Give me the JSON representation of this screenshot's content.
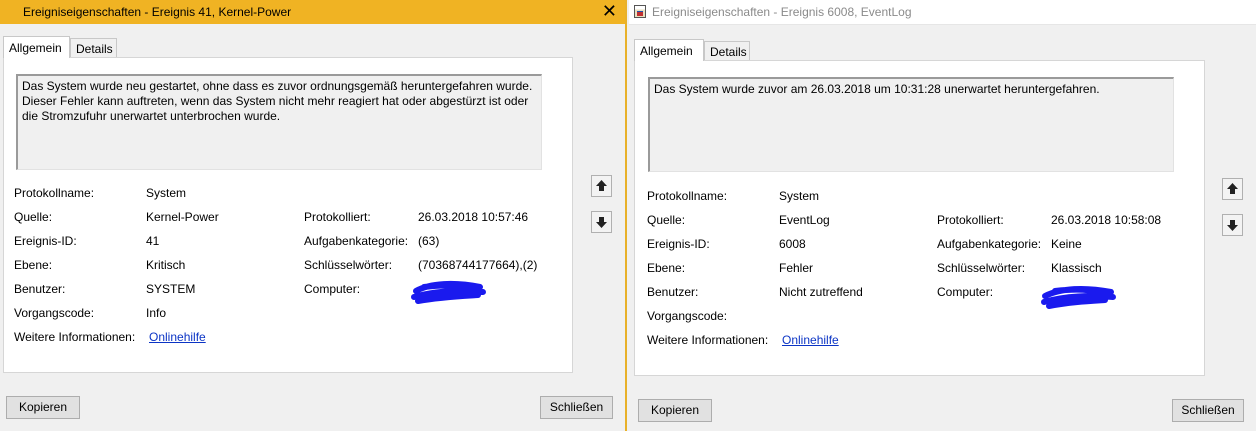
{
  "left": {
    "title": "Ereigniseigenschaften - Ereignis 41, Kernel-Power",
    "close_glyph": "✕",
    "tabs": [
      "Allgemein",
      "Details"
    ],
    "description": "Das System wurde neu gestartet, ohne dass es zuvor ordnungsgemäß heruntergefahren wurde. Dieser Fehler kann auftreten, wenn das System nicht mehr reagiert hat oder abgestürzt ist oder die Stromzufuhr unerwartet unterbrochen wurde.",
    "fields": {
      "protokollname_label": "Protokollname:",
      "protokollname": "System",
      "quelle_label": "Quelle:",
      "quelle": "Kernel-Power",
      "ereignis_id_label": "Ereignis-ID:",
      "ereignis_id": "41",
      "ebene_label": "Ebene:",
      "ebene": "Kritisch",
      "benutzer_label": "Benutzer:",
      "benutzer": "SYSTEM",
      "vorgangscode_label": "Vorgangscode:",
      "vorgangscode": "Info",
      "weitere_label": "Weitere Informationen:",
      "weitere_link": "Onlinehilfe",
      "protokolliert_label": "Protokolliert:",
      "protokolliert": "26.03.2018 10:57:46",
      "aufgabenkategorie_label": "Aufgabenkategorie:",
      "aufgabenkategorie": "(63)",
      "schluesselwoerter_label": "Schlüsselwörter:",
      "schluesselwoerter": "(70368744177664),(2)",
      "computer_label": "Computer:"
    },
    "buttons": {
      "copy": "Kopieren",
      "close": "Schließen"
    }
  },
  "right": {
    "title": "Ereigniseigenschaften - Ereignis 6008, EventLog",
    "tabs": [
      "Allgemein",
      "Details"
    ],
    "description": "Das System wurde zuvor am 26.03.2018 um 10:31:28 unerwartet heruntergefahren.",
    "fields": {
      "protokollname_label": "Protokollname:",
      "protokollname": "System",
      "quelle_label": "Quelle:",
      "quelle": "EventLog",
      "ereignis_id_label": "Ereignis-ID:",
      "ereignis_id": "6008",
      "ebene_label": "Ebene:",
      "ebene": "Fehler",
      "benutzer_label": "Benutzer:",
      "benutzer": "Nicht zutreffend",
      "vorgangscode_label": "Vorgangscode:",
      "weitere_label": "Weitere Informationen:",
      "weitere_link": "Onlinehilfe",
      "protokolliert_label": "Protokolliert:",
      "protokolliert": "26.03.2018 10:58:08",
      "aufgabenkategorie_label": "Aufgabenkategorie:",
      "aufgabenkategorie": "Keine",
      "schluesselwoerter_label": "Schlüsselwörter:",
      "schluesselwoerter": "Klassisch",
      "computer_label": "Computer:"
    },
    "buttons": {
      "copy": "Kopieren",
      "close": "Schließen"
    }
  },
  "colors": {
    "active_titlebar": "#f0b323",
    "link": "#0b34c5",
    "redaction": "#1a1aee"
  },
  "icons": [
    "event-window-icon",
    "close-icon",
    "arrow-up-icon",
    "arrow-down-icon"
  ]
}
